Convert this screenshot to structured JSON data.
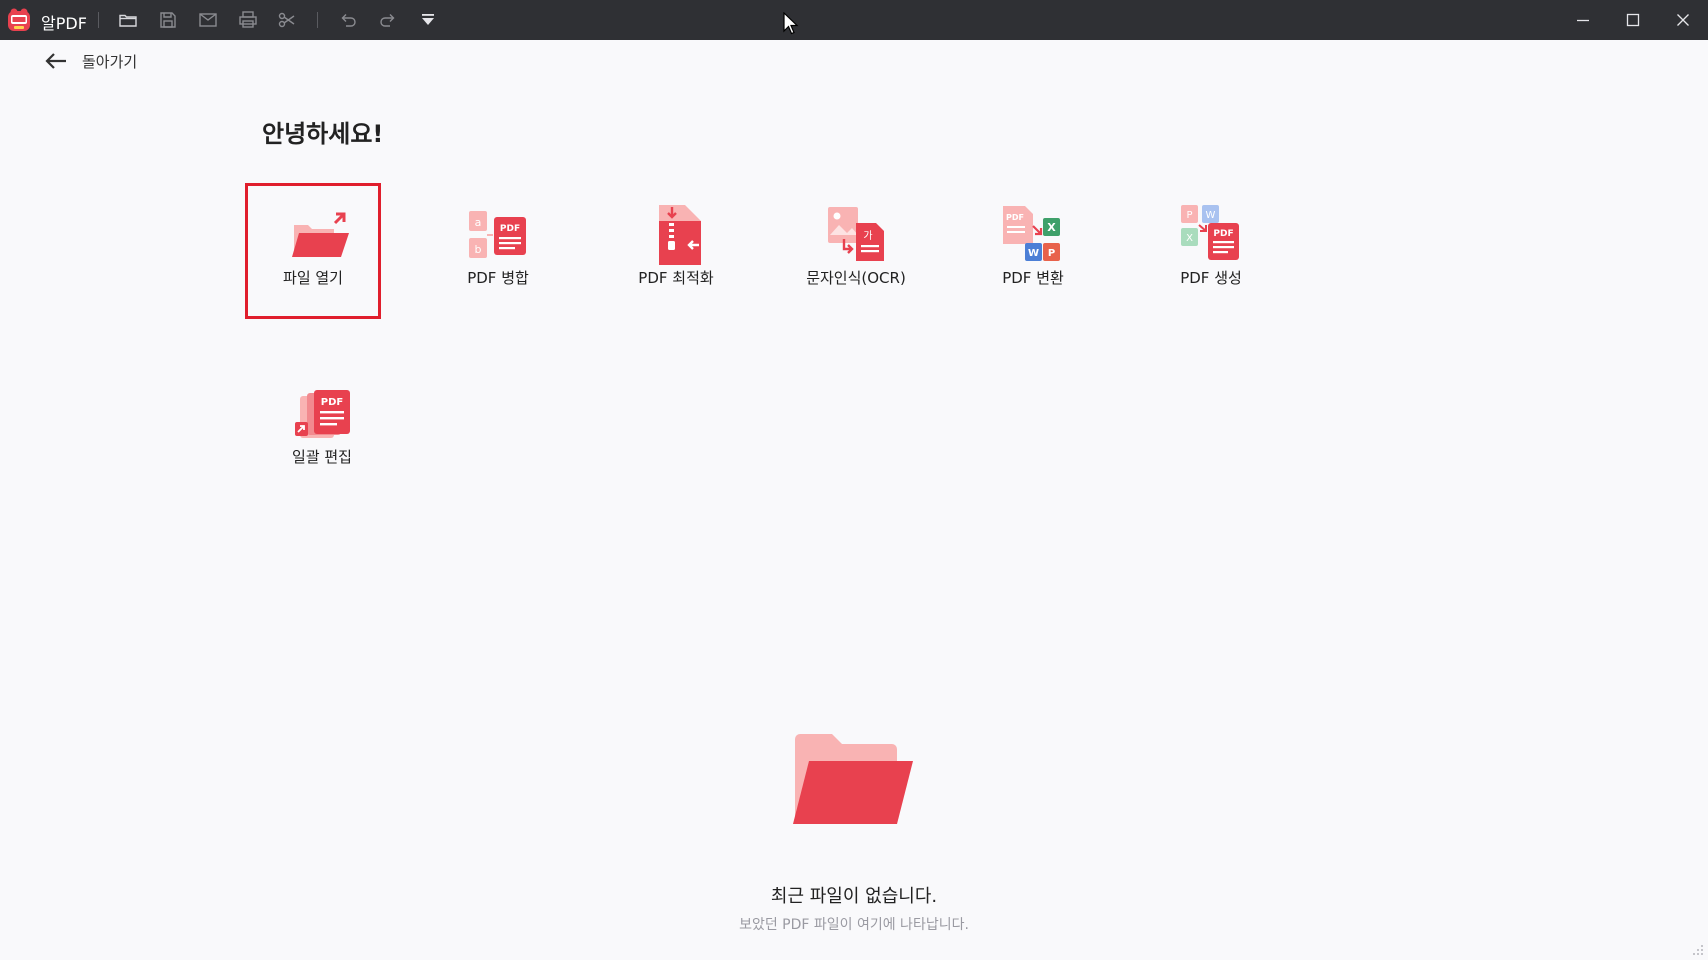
{
  "app": {
    "name": "알PDF"
  },
  "toolbar": {
    "icons": [
      "folder-open-icon",
      "save-icon",
      "mail-icon",
      "print-icon",
      "scissors-icon",
      "undo-icon",
      "redo-icon",
      "dropdown-icon"
    ]
  },
  "window_controls": [
    "minimize-icon",
    "maximize-icon",
    "close-icon"
  ],
  "nav": {
    "back_label": "돌아가기"
  },
  "greeting": "안녕하세요!",
  "tools": [
    {
      "label": "파일 열기",
      "icon": "open-file-icon",
      "selected": true
    },
    {
      "label": "PDF 병합",
      "icon": "merge-pdf-icon",
      "selected": false
    },
    {
      "label": "PDF 최적화",
      "icon": "compress-pdf-icon",
      "selected": false
    },
    {
      "label": "문자인식(OCR)",
      "icon": "ocr-icon",
      "selected": false
    },
    {
      "label": "PDF 변환",
      "icon": "convert-pdf-icon",
      "selected": false
    },
    {
      "label": "PDF 생성",
      "icon": "create-pdf-icon",
      "selected": false
    },
    {
      "label": "일괄 편집",
      "icon": "batch-edit-icon",
      "selected": false
    }
  ],
  "recent": {
    "empty_title": "최근 파일이 없습니다.",
    "empty_subtitle": "보았던 PDF 파일이 여기에 나타납니다."
  },
  "colors": {
    "titlebar": "#2f3034",
    "background": "#f9f9fb",
    "accent": "#e8414f",
    "accent_light": "#f9b3b3",
    "selection_outline": "#e01e2c"
  }
}
